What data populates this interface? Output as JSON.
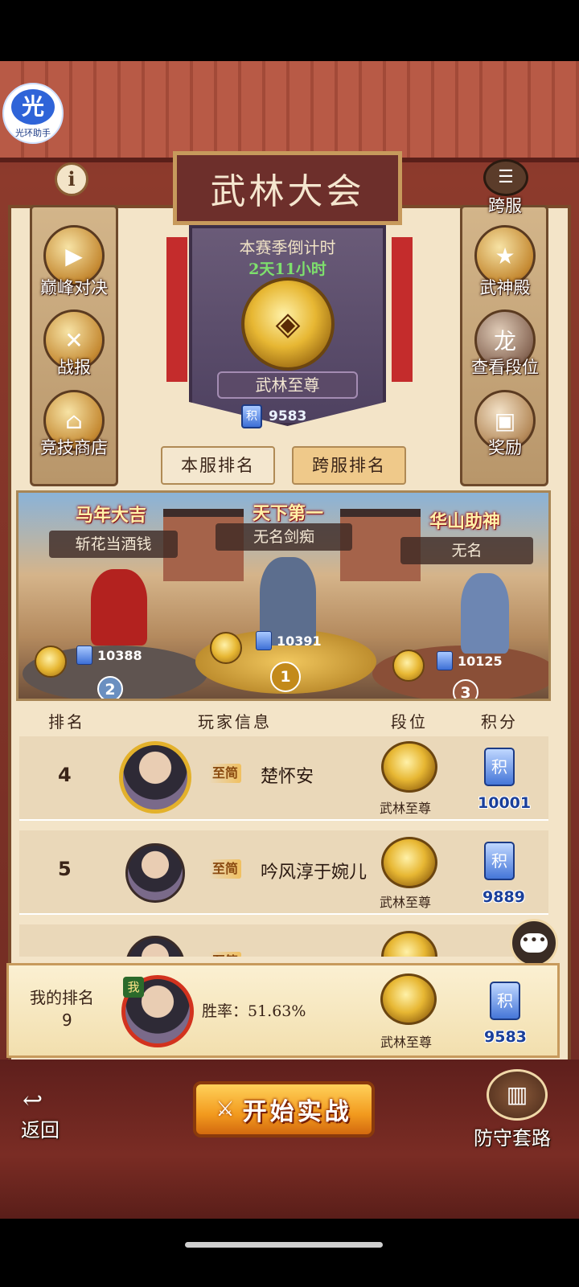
{
  "app": {
    "badge_glyph": "光",
    "badge_label": "光环助手"
  },
  "title": "武林大会",
  "season": {
    "countdown_label": "本赛季倒计时",
    "countdown_value": "2天11小时",
    "rank_name": "武林至尊",
    "score": "9583",
    "score_tag": "积"
  },
  "left_menu": [
    {
      "label": "巅峰对决",
      "icon": "play-icon"
    },
    {
      "label": "战报",
      "icon": "battle-report-icon"
    },
    {
      "label": "竞技商店",
      "icon": "shop-icon"
    }
  ],
  "right_menu": [
    {
      "label": "跨服",
      "icon": "list-icon"
    },
    {
      "label": "武神殿",
      "icon": "hall-icon"
    },
    {
      "label": "查看段位",
      "icon": "dragon-icon"
    },
    {
      "label": "奖励",
      "icon": "chest-icon"
    }
  ],
  "info_icon": "i",
  "tabs": {
    "local": "本服排名",
    "cross": "跨服排名"
  },
  "podium": [
    {
      "place": "1",
      "title": "天下第一",
      "name": "无名剑痴",
      "score": "10391"
    },
    {
      "place": "2",
      "title": "马年大吉",
      "name": "斩花当酒钱",
      "score": "10388"
    },
    {
      "place": "3",
      "title": "华山助神",
      "name": "无名",
      "score": "10125"
    }
  ],
  "table": {
    "headers": {
      "rank": "排名",
      "player": "玩家信息",
      "tier": "段位",
      "score": "积分"
    },
    "rows": [
      {
        "rank": "4",
        "vip": "至简",
        "name": "楚怀安",
        "tier": "武林至尊",
        "score": "10001"
      },
      {
        "rank": "5",
        "vip": "至简",
        "name": "吟风淳于婉儿",
        "tier": "武林至尊",
        "score": "9889"
      },
      {
        "rank": "",
        "vip": "至简",
        "name": "",
        "tier": "",
        "score": ""
      }
    ]
  },
  "my_rank": {
    "label": "我的排名",
    "rank": "9",
    "badge": "我",
    "win_rate_label": "胜率：51.63%",
    "tier": "武林至尊",
    "score": "9583"
  },
  "bottom": {
    "back": "返回",
    "start": "开始实战",
    "defense": "防守套路"
  },
  "colors": {
    "accent_gold": "#e7b733",
    "banner_red": "#6d2f2b",
    "cta_orange": "#f29a1e"
  }
}
